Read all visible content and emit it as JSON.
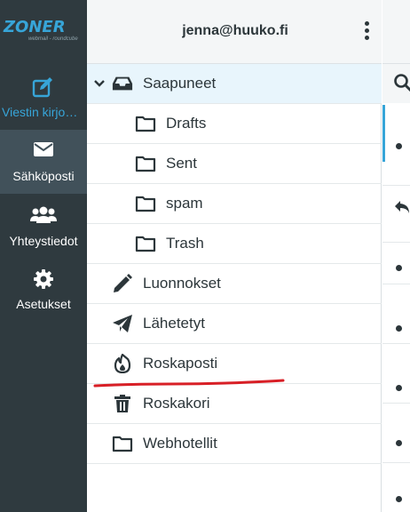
{
  "brand": {
    "logo_text": "ZONER",
    "logo_sub": "webmail - roundcube"
  },
  "nav": {
    "items": [
      {
        "label": "Viestin kirjo…",
        "icon": "compose-icon"
      },
      {
        "label": "Sähköposti",
        "icon": "envelope-icon"
      },
      {
        "label": "Yhteystiedot",
        "icon": "users-icon"
      },
      {
        "label": "Asetukset",
        "icon": "gear-icon"
      }
    ]
  },
  "header": {
    "account": "jenna@huuko.fi",
    "menu_icon": "kebab-menu-icon"
  },
  "folders": [
    {
      "label": "Saapuneet",
      "icon": "inbox-icon",
      "selected": true,
      "expanded": true
    },
    {
      "label": "Drafts",
      "icon": "folder-icon"
    },
    {
      "label": "Sent",
      "icon": "folder-icon"
    },
    {
      "label": "spam",
      "icon": "folder-icon"
    },
    {
      "label": "Trash",
      "icon": "folder-icon"
    },
    {
      "label": "Luonnokset",
      "icon": "pencil-icon"
    },
    {
      "label": "Lähetetyt",
      "icon": "paper-plane-icon"
    },
    {
      "label": "Roskaposti",
      "icon": "fire-icon"
    },
    {
      "label": "Roskakori",
      "icon": "trash-icon"
    },
    {
      "label": "Webhotellit",
      "icon": "folder-icon"
    }
  ],
  "colors": {
    "nav_bg": "#2f3a3f",
    "nav_active": "#41515a",
    "accent": "#37a5d8",
    "selected_row": "#e8f5fc",
    "annotation": "#d81f26"
  }
}
